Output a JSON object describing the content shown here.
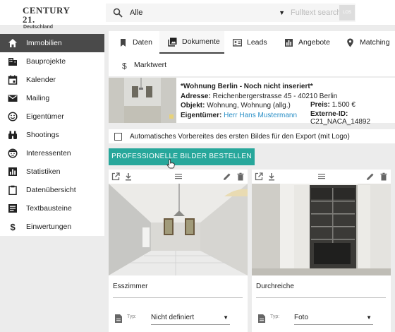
{
  "header": {
    "logo_main": "CENTURY 21.",
    "logo_sub": "Deutschland",
    "category_value": "Alle",
    "fulltext_placeholder": "Fulltext search",
    "search_button_label": "LOS"
  },
  "sidebar": {
    "items": [
      {
        "label": "Immobilien",
        "icon": "home-icon",
        "active": true
      },
      {
        "label": "Bauprojekte",
        "icon": "building-icon"
      },
      {
        "label": "Kalender",
        "icon": "calendar-icon"
      },
      {
        "label": "Mailing",
        "icon": "mail-icon"
      },
      {
        "label": "Eigentümer",
        "icon": "smiley-icon"
      },
      {
        "label": "Shootings",
        "icon": "binoculars-icon"
      },
      {
        "label": "Interessenten",
        "icon": "face-icon"
      },
      {
        "label": "Statistiken",
        "icon": "bar-chart-icon"
      },
      {
        "label": "Datenübersicht",
        "icon": "clipboard-icon"
      },
      {
        "label": "Textbausteine",
        "icon": "text-block-icon"
      },
      {
        "label": "Einwertungen",
        "icon": "dollar-icon"
      }
    ]
  },
  "tabs": [
    {
      "label": "Daten",
      "icon": "bookmark-icon"
    },
    {
      "label": "Dokumente",
      "icon": "photo-library-icon",
      "active": true
    },
    {
      "label": "Leads",
      "icon": "contact-card-icon"
    },
    {
      "label": "Angebote",
      "icon": "chart-box-icon"
    },
    {
      "label": "Matching",
      "icon": "location-pin-icon"
    },
    {
      "label": "Marktwert",
      "icon": "dollar-icon"
    }
  ],
  "property": {
    "title": "*Wohnung Berlin - Noch nicht inseriert*",
    "address_label": "Adresse:",
    "address": "Reichenbergerstrasse 45 - 40210 Berlin",
    "object_label": "Objekt:",
    "object": "Wohnung, Wohnung (allg.)",
    "price_label": "Preis:",
    "price": "1.500 €",
    "owner_label": "Eigentümer:",
    "owner": "Herr Hans Mustermann",
    "external_id_label": "Externe-ID:",
    "external_id": "C21_NACA_14892"
  },
  "export_checkbox_label": "Automatisches Vorbereites des ersten Bildes für den Export (mit Logo)",
  "order_button_label": "PROFESSIONELLE BILDER BESTELLEN",
  "cards": [
    {
      "caption": "Esszimmer",
      "type_label": "Typ:",
      "type_value": "Nicht definiert"
    },
    {
      "caption": "Durchreiche",
      "type_label": "Typ:",
      "type_value": "Foto"
    }
  ],
  "colors": {
    "accent": "#27a79b",
    "sidebar_active": "#4a4a4a",
    "link": "#2a8fc7"
  }
}
